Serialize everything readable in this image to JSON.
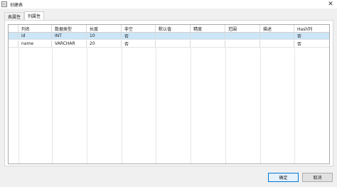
{
  "window": {
    "title": "创建表",
    "close_glyph": "✕",
    "icon": "app-icon"
  },
  "tabs": [
    {
      "label": "表属性",
      "active": false
    },
    {
      "label": "列属性",
      "active": true
    }
  ],
  "grid": {
    "columns": [
      "列名",
      "数据类型",
      "长度",
      "非空",
      "默认值",
      "精度",
      "范围",
      "描述",
      "Hash列"
    ],
    "rows": [
      {
        "selected": true,
        "cells": [
          "id",
          "INT",
          "10",
          "否",
          "",
          "",
          "",
          "",
          "否"
        ]
      },
      {
        "selected": false,
        "cells": [
          "name",
          "VARCHAR",
          "20",
          "否",
          "",
          "",
          "",
          "",
          "否"
        ]
      }
    ]
  },
  "buttons": {
    "ok_label": "确定",
    "cancel_label": "取消"
  },
  "colors": {
    "selected_row": "#cde6f7",
    "primary_border": "#0078d7"
  }
}
